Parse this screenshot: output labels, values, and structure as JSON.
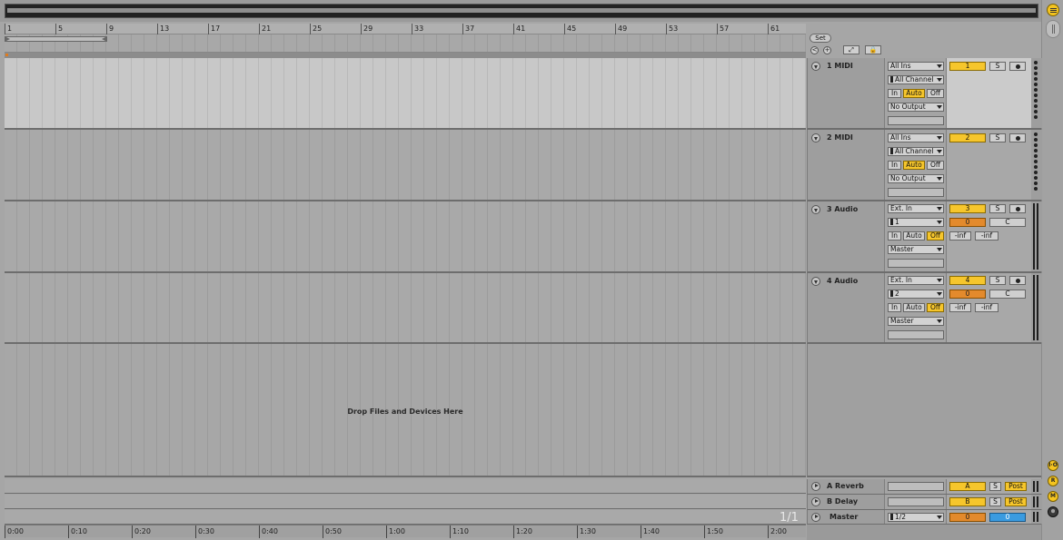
{
  "ruler": {
    "bars": [
      "1",
      "5",
      "9",
      "13",
      "17",
      "21",
      "25",
      "29",
      "33",
      "37",
      "41",
      "45",
      "49",
      "53",
      "57",
      "61"
    ]
  },
  "timeline": {
    "times": [
      "0:00",
      "0:10",
      "0:20",
      "0:30",
      "0:40",
      "0:50",
      "1:00",
      "1:10",
      "1:20",
      "1:30",
      "1:40",
      "1:50",
      "2:00"
    ]
  },
  "controls": {
    "set_label": "Set",
    "prev_label": "<",
    "add_label": "+",
    "expand_label": "⤢",
    "lock_label": "🔒"
  },
  "tracks": [
    {
      "name": "1 MIDI",
      "input_type": "All Ins",
      "input_channel": "All Channel",
      "monitor": [
        "In",
        "Auto",
        "Off"
      ],
      "output": "No Output",
      "number": "1",
      "solo": "S",
      "active_monitor": 1
    },
    {
      "name": "2 MIDI",
      "input_type": "All Ins",
      "input_channel": "All Channel",
      "monitor": [
        "In",
        "Auto",
        "Off"
      ],
      "output": "No Output",
      "number": "2",
      "solo": "S",
      "active_monitor": 1
    },
    {
      "name": "3 Audio",
      "input_type": "Ext. In",
      "input_channel": "1",
      "monitor": [
        "In",
        "Auto",
        "Off"
      ],
      "output": "Master",
      "number": "3",
      "solo": "S",
      "volume": "0",
      "pan": "C",
      "peak_l": "-inf",
      "peak_r": "-inf",
      "active_monitor": 2
    },
    {
      "name": "4 Audio",
      "input_type": "Ext. In",
      "input_channel": "2",
      "monitor": [
        "In",
        "Auto",
        "Off"
      ],
      "output": "Master",
      "number": "4",
      "solo": "S",
      "volume": "0",
      "pan": "C",
      "peak_l": "-inf",
      "peak_r": "-inf",
      "active_monitor": 2
    }
  ],
  "drop_area": {
    "message": "Drop Files and Devices Here"
  },
  "returns": [
    {
      "name": "A Reverb",
      "letter": "A",
      "solo": "S",
      "send_mode": "Post"
    },
    {
      "name": "B Delay",
      "letter": "B",
      "solo": "S",
      "send_mode": "Post"
    }
  ],
  "master": {
    "name": "Master",
    "cue_output": "1/2",
    "volume": "0",
    "cue_volume": "0"
  },
  "page_indicator": "1/1",
  "side_buttons": [
    "I·O",
    "R",
    "M",
    "⊗"
  ],
  "colors": {
    "accent": "#f6c62c",
    "orange": "#e38a2c",
    "blue": "#3a9be0"
  }
}
